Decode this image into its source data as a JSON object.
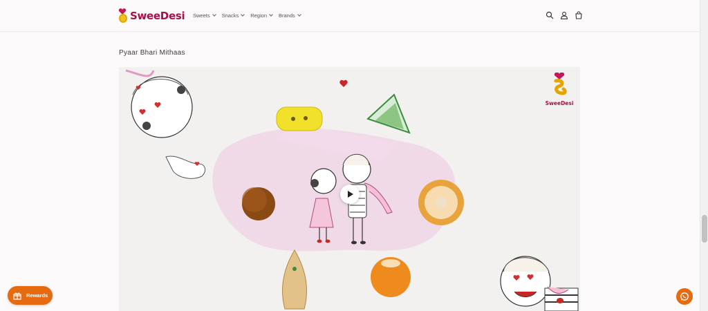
{
  "header": {
    "logo_text": "SweeDesi",
    "nav": [
      {
        "label": "Sweets"
      },
      {
        "label": "Snacks"
      },
      {
        "label": "Region"
      },
      {
        "label": "Brands"
      }
    ],
    "icons": [
      "search-icon",
      "account-icon",
      "cart-icon"
    ]
  },
  "section": {
    "title": "Pyaar Bhari Mithaas",
    "video": {
      "watermark_text": "SweeDesi",
      "play_label": "Play"
    }
  },
  "widgets": {
    "rewards_label": "Rewards",
    "whatsapp_icon": "whatsapp-icon"
  },
  "colors": {
    "brand": "#a8104a",
    "accent": "#e66a0f",
    "logo_gold": "#f3c022"
  }
}
